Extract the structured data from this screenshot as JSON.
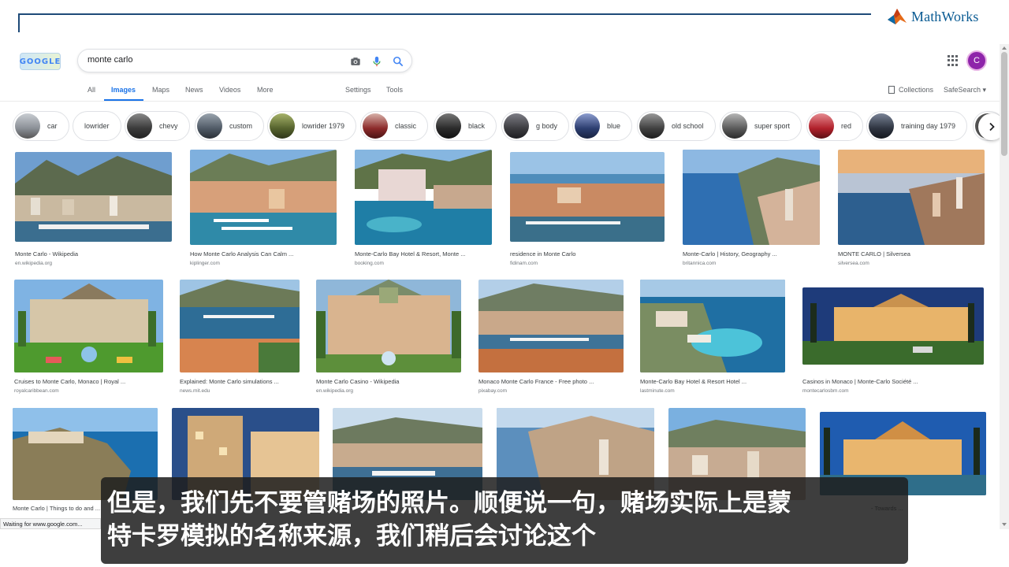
{
  "brand": {
    "name": "MathWorks",
    "logo_icon": "mathworks-membrane-icon"
  },
  "google": {
    "logo_text": "GOOGLE",
    "search": {
      "value": "monte carlo",
      "icons": [
        "camera-icon",
        "mic-icon",
        "search-icon"
      ]
    },
    "tabs": [
      "All",
      "Images",
      "Maps",
      "News",
      "Videos",
      "More"
    ],
    "active_tab": "Images",
    "tools": {
      "settings": "Settings",
      "tools": "Tools"
    },
    "collections": "Collections",
    "safesearch": "SafeSearch ▾",
    "avatar_letter": "C",
    "accent": "#1a73e8"
  },
  "chips": [
    {
      "label": "car",
      "color": "#8a8f96"
    },
    {
      "label": "lowrider",
      "color": null
    },
    {
      "label": "chevy",
      "color": "#3a3a3a"
    },
    {
      "label": "custom",
      "color": "#505a66"
    },
    {
      "label": "lowrider 1979",
      "color": "#55622d"
    },
    {
      "label": "classic",
      "color": "#8c2a2a"
    },
    {
      "label": "black",
      "color": "#2a2a2a"
    },
    {
      "label": "g body",
      "color": "#3c3c40"
    },
    {
      "label": "blue",
      "color": "#2c3e70"
    },
    {
      "label": "old school",
      "color": "#404040"
    },
    {
      "label": "super sport",
      "color": "#5a5a5a"
    },
    {
      "label": "red",
      "color": "#b0202a"
    },
    {
      "label": "training day 1979",
      "color": "#2e3440"
    }
  ],
  "results": [
    {
      "caption": "Monte Carlo - Wikipedia",
      "source": "en.wikipedia.org"
    },
    {
      "caption": "How Monte Carlo Analysis Can Calm ...",
      "source": "kiplinger.com"
    },
    {
      "caption": "Monte-Carlo Bay Hotel & Resort, Monte ...",
      "source": "booking.com"
    },
    {
      "caption": "residence in Monte Carlo",
      "source": "fidinam.com"
    },
    {
      "caption": "Monte-Carlo | History, Geography ...",
      "source": "britannica.com"
    },
    {
      "caption": "MONTE CARLO | Silversea",
      "source": "silversea.com"
    },
    {
      "caption": "Cruises to Monte Carlo, Monaco | Royal ...",
      "source": "royalcaribbean.com"
    },
    {
      "caption": "Explained: Monte Carlo simulations ...",
      "source": "news.mit.edu"
    },
    {
      "caption": "Monte Carlo Casino - Wikipedia",
      "source": "en.wikipedia.org"
    },
    {
      "caption": "Monaco Monte Carlo France - Free photo ...",
      "source": "pixabay.com"
    },
    {
      "caption": "Monte-Carlo Bay Hotel & Resort Hotel ...",
      "source": "lastminute.com"
    },
    {
      "caption": "Casinos in Monaco | Monte-Carlo Société ...",
      "source": "montecarlosbm.com"
    },
    {
      "caption": "Monte Carlo | Things to do and ...",
      "source": ""
    },
    {
      "caption": "",
      "source": ""
    },
    {
      "caption": "",
      "source": ""
    },
    {
      "caption": "",
      "source": ""
    },
    {
      "caption": "",
      "source": ""
    },
    {
      "caption": "- Towards ...",
      "source": ""
    }
  ],
  "status": "Waiting for www.google.com...",
  "subtitle": {
    "line1": "但是，我们先不要管赌场的照片。顺便说一句，赌场实际上是蒙",
    "line2": "特卡罗模拟的名称来源，我们稍后会讨论这个"
  }
}
